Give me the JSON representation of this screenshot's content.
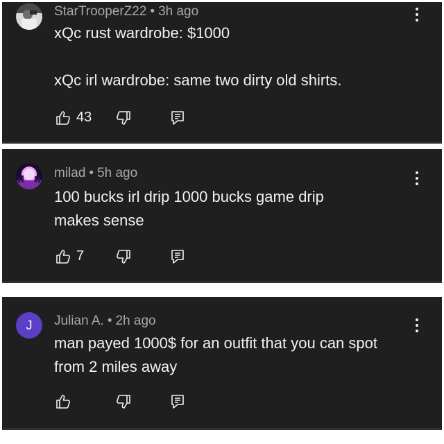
{
  "comments": [
    {
      "author": "StarTrooperZ22",
      "time": "3h ago",
      "avatar_icon": "user-photo-avatar",
      "lines": [
        "xQc rust wardrobe: $1000",
        "",
        "xQc irl wardrobe: same two dirty old shirts."
      ],
      "likes": "43"
    },
    {
      "author": "milad",
      "time": "5h ago",
      "avatar_icon": "purple-moon-city-avatar",
      "lines": [
        "100 bucks irl drip 1000 bucks game drip",
        "makes sense"
      ],
      "likes": "7"
    },
    {
      "author": "Julian A.",
      "time": "2h ago",
      "avatar_letter": "J",
      "avatar_color": "#5b3fc4",
      "lines": [
        "man payed 1000$ for an outfit that you can spot",
        "from 2 miles away"
      ],
      "likes": ""
    }
  ],
  "separator": "•",
  "icons": {
    "like": "thumbs-up-icon",
    "dislike": "thumbs-down-icon",
    "reply": "reply-comment-icon",
    "menu": "more-vertical-icon"
  },
  "colors": {
    "card_bg": "#1f1f1f",
    "page_bg": "#ffffff",
    "meta_text": "#a8a8a8",
    "body_text": "#f1f1f1"
  }
}
